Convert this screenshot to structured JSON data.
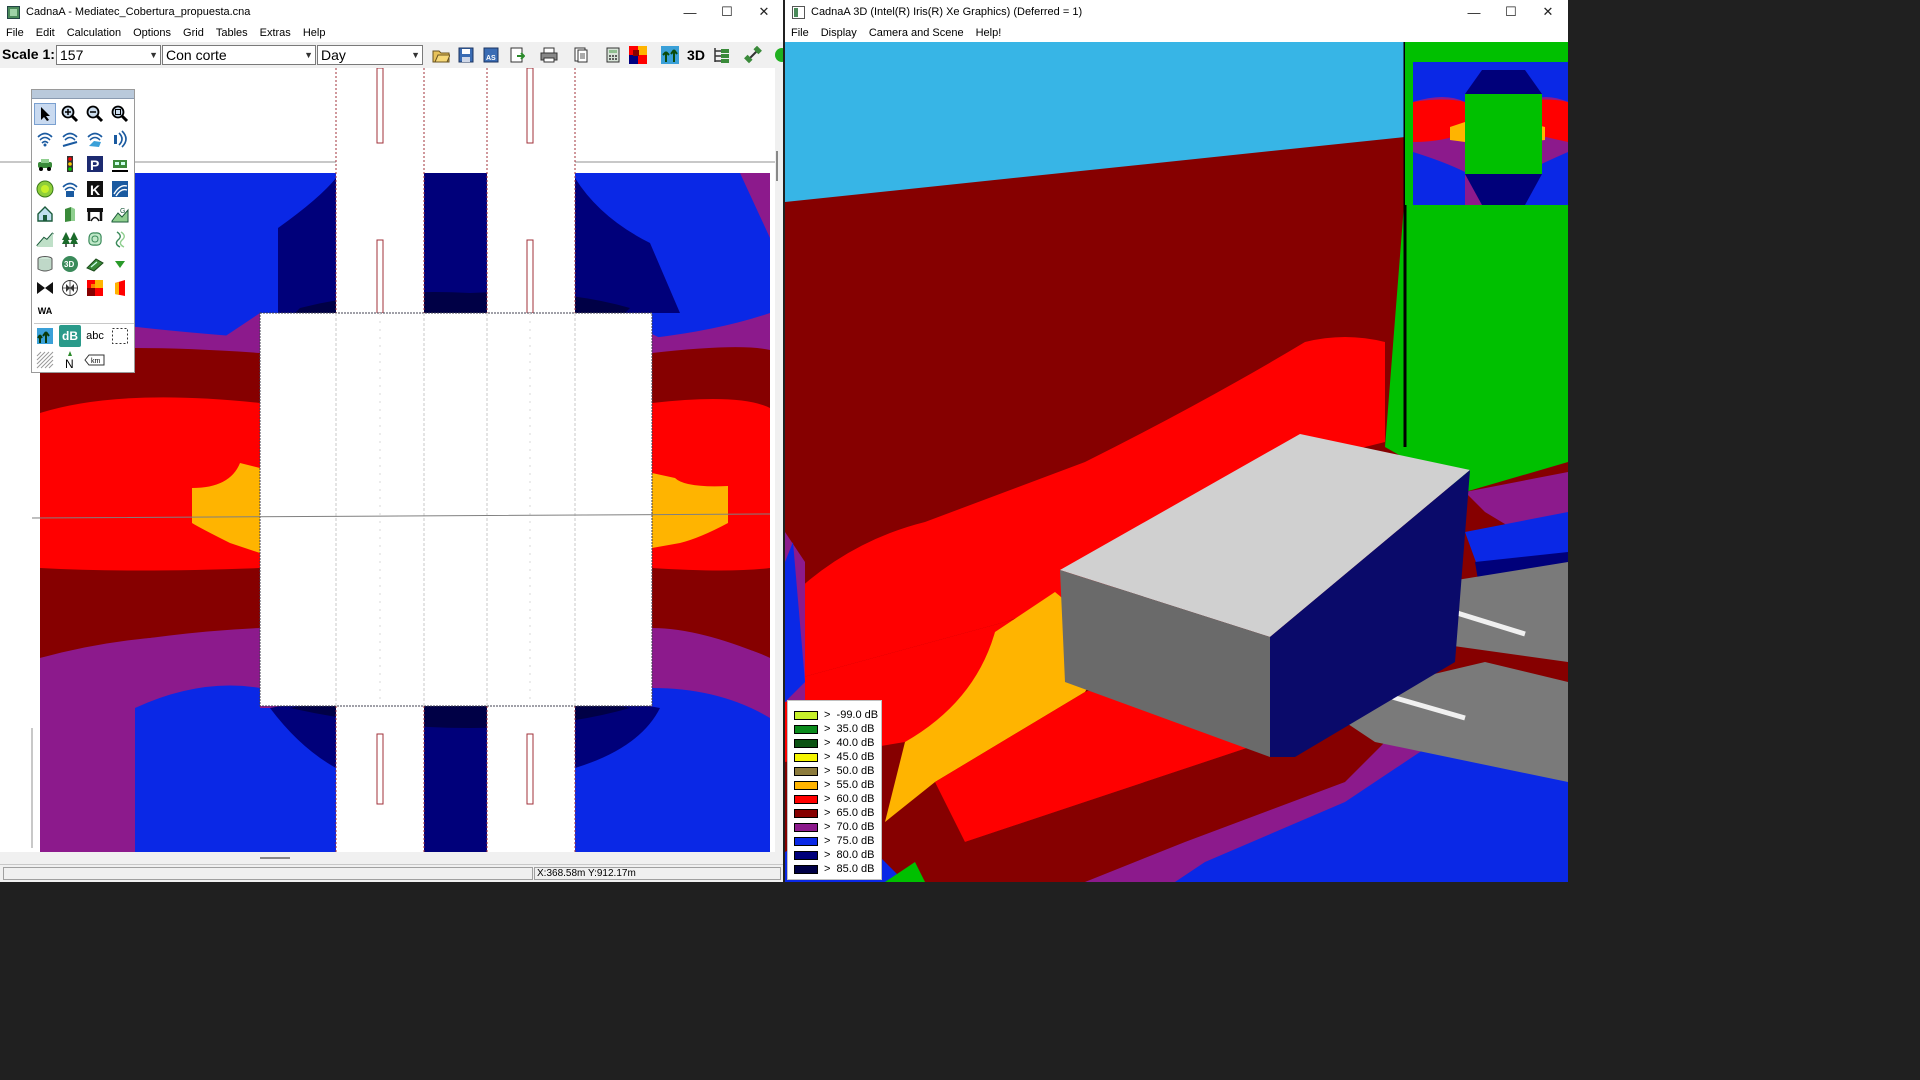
{
  "left_window": {
    "title": "CadnaA - Mediatec_Cobertura_propuesta.cna",
    "controls": {
      "minimize": "—",
      "maximize": "☐",
      "close": "✕"
    },
    "menu": [
      "File",
      "Edit",
      "Calculation",
      "Options",
      "Grid",
      "Tables",
      "Extras",
      "Help"
    ],
    "toolbar": {
      "scale_label": "Scale 1:",
      "scale_value": "157",
      "variant_value": "Con corte",
      "period_value": "Day",
      "btn_3d": "3D",
      "tool_icons": [
        "open-icon",
        "save-icon",
        "save-as-icon",
        "export-icon",
        "print-icon",
        "page-icon",
        "calculator-icon",
        "grid-color-icon",
        "tree-icon",
        "3d-icon",
        "hierarchy-icon",
        "satellite-icon",
        "status-light-icon"
      ]
    },
    "palette": {
      "tools": [
        "pointer-icon",
        "zoom-in-icon",
        "zoom-out-icon",
        "zoom-fit-icon",
        "point-source-icon",
        "line-source-icon",
        "area-source-icon",
        "vertical-source-icon",
        "road-icon",
        "traffic-light-icon",
        "parking-icon",
        "railway-icon",
        "industrial-icon",
        "sound-emitter-icon",
        "k-icon",
        "wall-source-icon",
        "building-icon",
        "barrier-icon",
        "bridge-icon",
        "terrain-icon",
        "embankment-icon",
        "trees-icon",
        "contour-icon",
        "height-line-icon",
        "cylinder-icon",
        "3d-object-icon",
        "ground-area-icon",
        "arrow-down-icon",
        "receiver-icon",
        "grid-receiver-icon",
        "color-map-icon",
        "facade-icon",
        "wa-icon",
        "image-icon",
        "db-icon",
        "text-icon",
        "selection-box-icon",
        "hatch-icon",
        "north-arrow-icon",
        "scale-bar-icon"
      ],
      "labels": {
        "wa": "WA",
        "db": "dB",
        "abc": "abc",
        "north": "N",
        "km": "km"
      }
    },
    "status": {
      "coords": "X:368.58m Y:912.17m"
    }
  },
  "right_window": {
    "title": "CadnaA 3D (Intel(R) Iris(R) Xe Graphics) (Deferred = 1)",
    "controls": {
      "minimize": "—",
      "maximize": "☐",
      "close": "✕"
    },
    "menu": [
      "File",
      "Display",
      "Camera and Scene",
      "Help!"
    ],
    "legend": [
      {
        "label": ">  -99.0 dB",
        "color": "#c6f02a"
      },
      {
        "label": ">  35.0 dB",
        "color": "#0a8a1c"
      },
      {
        "label": ">  40.0 dB",
        "color": "#0b5212"
      },
      {
        "label": ">  45.0 dB",
        "color": "#f5f500"
      },
      {
        "label": ">  50.0 dB",
        "color": "#8c7b3c"
      },
      {
        "label": ">  55.0 dB",
        "color": "#ffb400"
      },
      {
        "label": ">  60.0 dB",
        "color": "#ff0000"
      },
      {
        "label": ">  65.0 dB",
        "color": "#860000"
      },
      {
        "label": ">  70.0 dB",
        "color": "#8c1a8c"
      },
      {
        "label": ">  75.0 dB",
        "color": "#0a28e6"
      },
      {
        "label": ">  80.0 dB",
        "color": "#00007a"
      },
      {
        "label": ">  85.0 dB",
        "color": "#000046"
      }
    ]
  }
}
